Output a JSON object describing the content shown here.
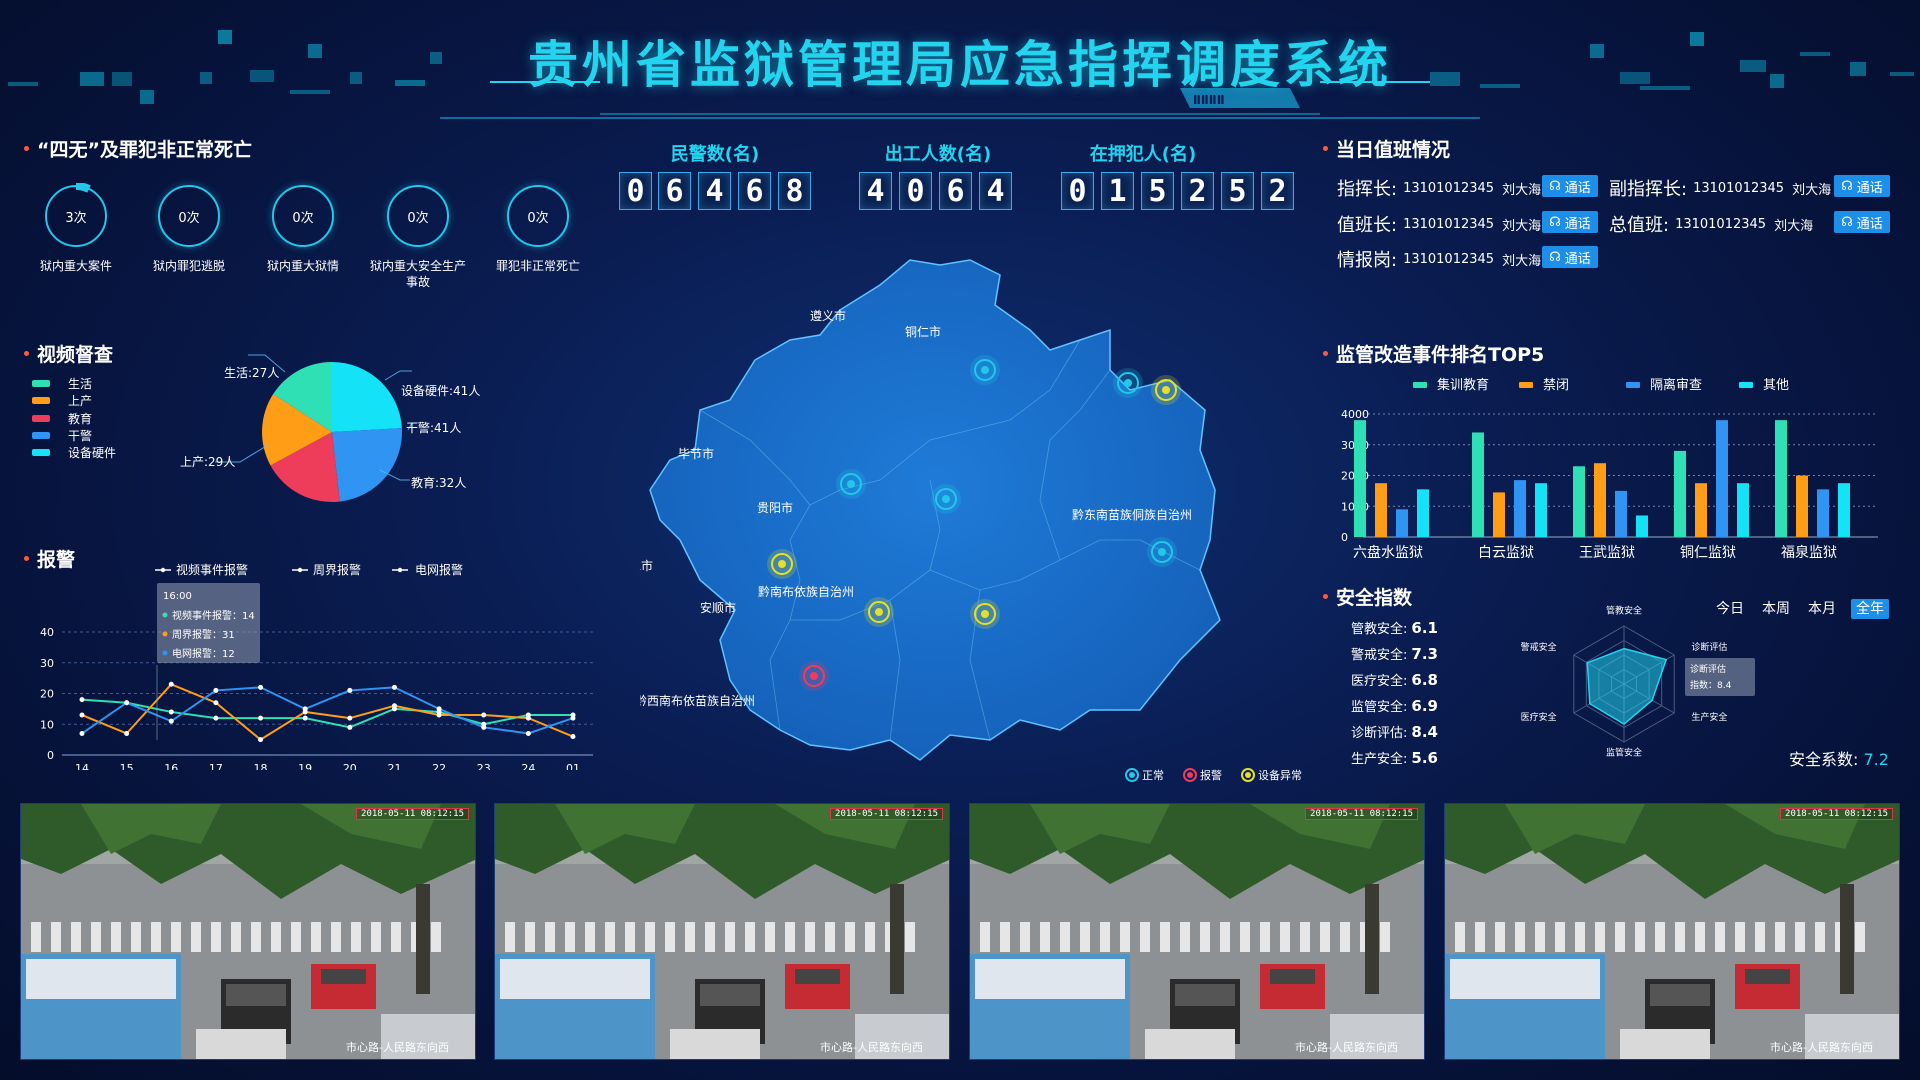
{
  "title": "贵州省监狱管理局应急指挥调度系统",
  "deaths": {
    "title": "“四无”及罪犯非正常死亡",
    "items": [
      {
        "value": "3次",
        "label": "狱内重大案件"
      },
      {
        "value": "0次",
        "label": "狱内罪犯逃脱"
      },
      {
        "value": "0次",
        "label": "狱内重大狱情"
      },
      {
        "value": "0次",
        "label": "狱内重大安全生产事故"
      },
      {
        "value": "0次",
        "label": "罪犯非正常死亡"
      }
    ]
  },
  "video": {
    "title": "视频督查",
    "legend": [
      {
        "label": "生活",
        "color": "#2fe0b4"
      },
      {
        "label": "上产",
        "color": "#ff9d16"
      },
      {
        "label": "教育",
        "color": "#ee3c5b"
      },
      {
        "label": "干警",
        "color": "#2f94f2"
      },
      {
        "label": "设备硬件",
        "color": "#14e2f6"
      }
    ],
    "pie_labels": [
      "生活:27人",
      "设备硬件:41人",
      "干警:41人",
      "教育:32人",
      "上产:29人"
    ]
  },
  "alarm": {
    "title": "报警",
    "legend": [
      "视频事件报警",
      "周界报警",
      "电网报警"
    ],
    "tooltip": {
      "title": "16:00",
      "rows": [
        "视频事件报警：14",
        "周界报警：31",
        "电网报警：12"
      ]
    }
  },
  "counters": [
    {
      "label": "民警数(名)",
      "digits": [
        "0",
        "6",
        "4",
        "6",
        "8"
      ]
    },
    {
      "label": "出工人数(名)",
      "digits": [
        "4",
        "0",
        "6",
        "4"
      ]
    },
    {
      "label": "在押犯人(名)",
      "digits": [
        "0",
        "1",
        "5",
        "2",
        "5",
        "2"
      ]
    }
  ],
  "map": {
    "cities": [
      "遵义市",
      "铜仁市",
      "毕节市",
      "贵阳市",
      "黔东南苗族侗族自治州",
      "六盘水市",
      "安顺市",
      "黔南布依族自治州",
      "黔西南布依苗族自治州"
    ],
    "legend": [
      "正常",
      "报警",
      "设备异常"
    ]
  },
  "duty": {
    "title": "当日值班情况",
    "call": "通话",
    "rows": [
      {
        "role": "指挥长:",
        "phone": "13101012345",
        "name": "刘大海"
      },
      {
        "role": "副指挥长:",
        "phone": "13101012345",
        "name": "刘大海"
      },
      {
        "role": "值班长:",
        "phone": "13101012345",
        "name": "刘大海"
      },
      {
        "role": "总值班:",
        "phone": "13101012345",
        "name": "刘大海"
      },
      {
        "role": "情报岗:",
        "phone": "13101012345",
        "name": "刘大海"
      }
    ]
  },
  "top5": {
    "title": "监管改造事件排名TOP5"
  },
  "safety": {
    "title": "安全指数",
    "rows": [
      {
        "label": "管教安全:",
        "value": "6.1"
      },
      {
        "label": "警戒安全:",
        "value": "7.3"
      },
      {
        "label": "医疗安全:",
        "value": "6.8"
      },
      {
        "label": "监管安全:",
        "value": "6.9"
      },
      {
        "label": "诊断评估:",
        "value": "8.4"
      },
      {
        "label": "生产安全:",
        "value": "5.6"
      }
    ],
    "periods": [
      "今日",
      "本周",
      "本月",
      "全年"
    ],
    "coef_label": "安全系数:",
    "coef_value": "7.2",
    "tooltip": {
      "title": "诊断评估",
      "value": "指数：8.4"
    }
  },
  "cameras": [
    {
      "timestamp": "2018-05-11 08:12:15",
      "caption": "市心路-人民路东向西"
    },
    {
      "timestamp": "2018-05-11 08:12:15",
      "caption": "市心路-人民路东向西"
    },
    {
      "timestamp": "2018-05-11 08:12:15",
      "caption": "市心路-人民路东向西"
    },
    {
      "timestamp": "2018-05-11 08:12:15",
      "caption": "市心路-人民路东向西"
    }
  ],
  "chart_data": [
    {
      "type": "pie",
      "title": "视频督查",
      "categories": [
        "生活",
        "上产",
        "教育",
        "干警",
        "设备硬件"
      ],
      "values": [
        27,
        29,
        32,
        41,
        41
      ],
      "colors": [
        "#2fe0b4",
        "#ff9d16",
        "#ee3c5b",
        "#2f94f2",
        "#14e2f6"
      ]
    },
    {
      "type": "line",
      "title": "报警",
      "x": [
        "14",
        "15",
        "16",
        "17",
        "18",
        "19",
        "20",
        "21",
        "22",
        "23",
        "24",
        "01"
      ],
      "ylim": [
        0,
        40
      ],
      "yticks": [
        0,
        10,
        20,
        30,
        40
      ],
      "series": [
        {
          "name": "视频事件报警",
          "color": "#2fe0b4",
          "values": [
            18,
            17,
            14,
            12,
            12,
            12,
            9,
            15,
            14,
            10,
            13,
            13
          ]
        },
        {
          "name": "周界报警",
          "color": "#ff9d16",
          "values": [
            13,
            7,
            23,
            17,
            5,
            14,
            12,
            16,
            13,
            13,
            12,
            6
          ]
        },
        {
          "name": "电网报警",
          "color": "#2f94f2",
          "values": [
            7,
            17,
            11,
            21,
            22,
            15,
            21,
            22,
            15,
            9,
            7,
            12
          ]
        }
      ],
      "grid": true,
      "legend": "top"
    },
    {
      "type": "bar",
      "title": "监管改造事件排名TOP5",
      "categories": [
        "六盘水监狱",
        "白云监狱",
        "王武监狱",
        "铜仁监狱",
        "福泉监狱"
      ],
      "series": [
        {
          "name": "集训教育",
          "color": "#2fe0b4",
          "values": [
            3800,
            3400,
            2300,
            2800,
            3800
          ]
        },
        {
          "name": "禁闭",
          "color": "#ff9d16",
          "values": [
            1750,
            1450,
            2400,
            1750,
            2000
          ]
        },
        {
          "name": "隔离审查",
          "color": "#2f94f2",
          "values": [
            900,
            1850,
            1500,
            3800,
            1550
          ]
        },
        {
          "name": "其他",
          "color": "#14e2f6",
          "values": [
            1550,
            1750,
            700,
            1750,
            1750
          ]
        }
      ],
      "ylim": [
        0,
        4000
      ],
      "yticks": [
        0,
        1000,
        2000,
        3000,
        4000
      ],
      "legend": "top",
      "grid": true
    },
    {
      "type": "radar",
      "title": "安全指数",
      "axes": [
        "管教安全",
        "诊断评估",
        "生产安全",
        "监管安全",
        "医疗安全",
        "警戒安全"
      ],
      "values": [
        6.1,
        8.4,
        5.6,
        6.9,
        6.8,
        7.3
      ],
      "max": 10
    }
  ]
}
